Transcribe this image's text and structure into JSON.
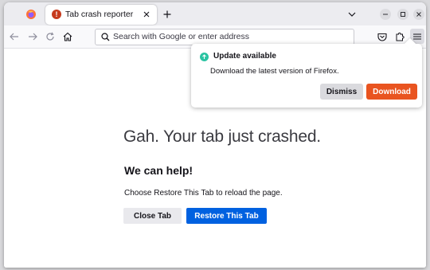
{
  "tab": {
    "title": "Tab crash reporter",
    "icon": "crash-warning-icon",
    "close_icon": "close-icon"
  },
  "toolbar": {
    "new_tab_icon": "plus-icon",
    "list_tabs_icon": "chevron-down-icon",
    "back_icon": "back-arrow-icon",
    "forward_icon": "forward-arrow-icon",
    "reload_icon": "reload-icon",
    "home_icon": "home-icon",
    "pocket_icon": "pocket-icon",
    "extensions_icon": "puzzle-icon",
    "menu_icon": "hamburger-menu-icon"
  },
  "urlbar": {
    "placeholder": "Search with Google or enter address"
  },
  "window_controls": {
    "minimize_icon": "minimize-icon",
    "maximize_icon": "maximize-icon",
    "close_icon": "close-icon"
  },
  "update_popup": {
    "title": "Update available",
    "body": "Download the latest version of Firefox.",
    "dismiss_label": "Dismiss",
    "download_label": "Download",
    "accent_color": "#e95420"
  },
  "crash_page": {
    "title": "Gah. Your tab just crashed.",
    "help_title": "We can help!",
    "help_text": "Choose Restore This Tab to reload the page.",
    "close_tab_label": "Close Tab",
    "restore_label": "Restore This Tab",
    "primary_color": "#0061e0"
  }
}
